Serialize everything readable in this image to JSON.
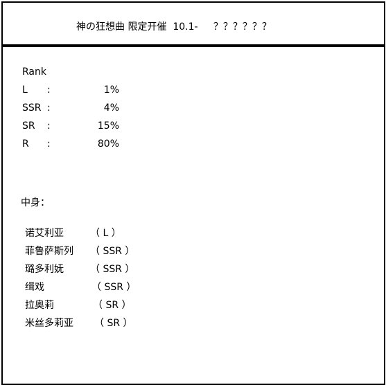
{
  "header": {
    "title": "神の狂想曲 限定开催  10.1-     ？？？？？？"
  },
  "rank_section": {
    "heading": "Rank",
    "rows": [
      {
        "rank": "L",
        "colon": ":",
        "percent": "1%"
      },
      {
        "rank": "SSR",
        "colon": ":",
        "percent": "4%"
      },
      {
        "rank": "SR",
        "colon": ":",
        "percent": "15%"
      },
      {
        "rank": "R",
        "colon": ":",
        "percent": "80%"
      }
    ]
  },
  "contents_section": {
    "heading": "中身：",
    "items": [
      {
        "name": "诺艾利亚",
        "rarity": "（ L ）"
      },
      {
        "name": "菲鲁萨斯列",
        "rarity": "（ SSR ）"
      },
      {
        "name": "璐多利妩",
        "rarity": "（ SSR ）"
      },
      {
        "name": "缉戏",
        "rarity": "（ SSR ）"
      },
      {
        "name": "拉奥莉",
        "rarity": "（ SR ）"
      },
      {
        "name": "米丝多莉亚",
        "rarity": "（ SR ）"
      }
    ]
  }
}
